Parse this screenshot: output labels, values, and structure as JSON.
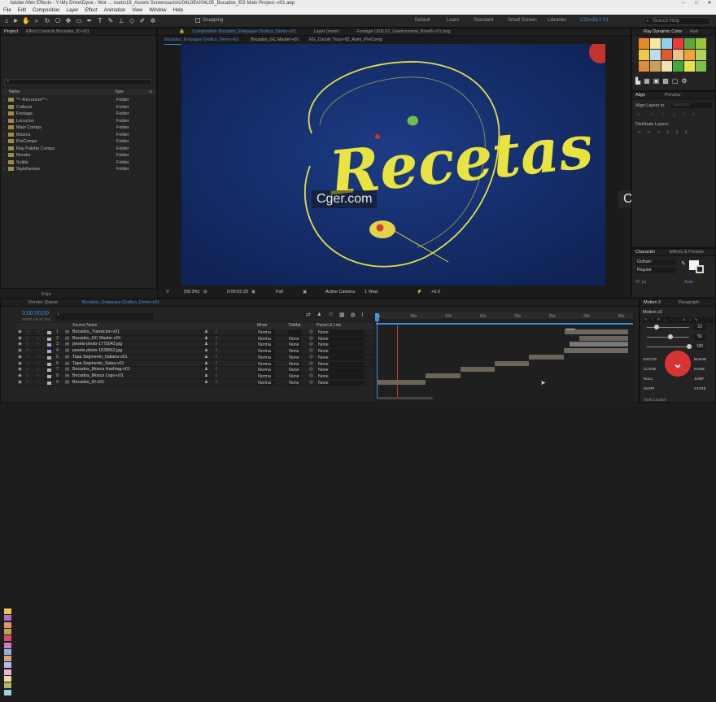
{
  "titlebar": {
    "title": "Adobe After Effects - Y:\\My Drive\\Dyne - Wor ... ssets\\18_Assets Screencasts\\U04L05\\U04L05_Bocados_EG Main Project--v01.aep"
  },
  "menu": [
    "File",
    "Edit",
    "Composition",
    "Layer",
    "Effect",
    "Animation",
    "View",
    "Window",
    "Help"
  ],
  "toolbar": {
    "snapping": "Snapping",
    "workspaces": [
      "Default",
      "Learn",
      "Standard",
      "Small Screen",
      "Libraries",
      "COnsDLY 01"
    ],
    "active_workspace": "COnsDLY 01",
    "search_placeholder": "Search Help"
  },
  "project": {
    "tab": "Project",
    "effect_tab": "Effect Controls Bocados_ID-v01",
    "col_name": "Name",
    "col_type": "Type",
    "items": [
      {
        "name": "**--Recursos**--",
        "type": "Folder"
      },
      {
        "name": "Collects",
        "type": "Folder"
      },
      {
        "name": "Footage",
        "type": "Folder"
      },
      {
        "name": "Locucion",
        "type": "Folder"
      },
      {
        "name": "Main Comps",
        "type": "Folder"
      },
      {
        "name": "Musica",
        "type": "Folder"
      },
      {
        "name": "PreComps",
        "type": "Folder"
      },
      {
        "name": "Ray Palette Comps",
        "type": "Folder"
      },
      {
        "name": "Render",
        "type": "Folder"
      },
      {
        "name": "Solids",
        "type": "Folder"
      },
      {
        "name": "Styleframes",
        "type": "Folder"
      }
    ],
    "bpc": "8 bpc"
  },
  "comp": {
    "tab1": "Composition Bocados_Empaque Grafico_Demo-v01",
    "tab2": "Layer (none)",
    "tab3": "Footage U03L02_Gastronomia_Bowl6-v01.png",
    "sub1": "Bocados_Empaque Grafico_Demo-v01",
    "sub2": "Bocados_GC Master-v01",
    "sub3": "EG_Circulo Trazo-02_Anim_PreComp",
    "title_text": "Recetas",
    "zoom": "(59.3%)",
    "timecode": "0:00:02:29",
    "resolution": "Full",
    "camera": "Active Camera",
    "view": "1 View",
    "offset": "+0.0"
  },
  "watermark": "Cger.com",
  "ray": {
    "tab": "Ray Dynamic Color",
    "tab2": "Aud",
    "colors": [
      "#e9882a",
      "#f4eba0",
      "#8fd0ea",
      "#ea3a3a",
      "#5aa83a",
      "#9ec43a",
      "#f0c94a",
      "#b7e0ea",
      "#e05a2a",
      "#e9c48a",
      "#f0a33a",
      "#b0d35c",
      "#e28a3a",
      "#c8a060",
      "#f2e0b0",
      "#3fa83f",
      "#e8e24a",
      "#7ac04a"
    ]
  },
  "align": {
    "tab": "Align",
    "tab2": "Preview",
    "align_to": "Align Layers to:",
    "selection": "Selection",
    "distribute": "Distribute Layers:"
  },
  "character": {
    "tab": "Character",
    "tab2": "Effects & Presets",
    "font": "Gotham",
    "style": "Regular",
    "size": "47 px",
    "leading": "Auto"
  },
  "motion": {
    "tab": "Motion 2",
    "tab2": "Paragraph",
    "name": "Motion v2",
    "v1": "23",
    "v2": "56",
    "v3": "100",
    "buttons": [
      "EXCITE",
      "BLEND",
      "CLONE",
      "NAME",
      "NULL",
      "JUMP",
      "SORT",
      "WARP",
      "STARE"
    ],
    "footer": "Task Launch"
  },
  "timeline": {
    "render_tab": "Render Queue",
    "comp_tab": "Bocados_Empaque Grafico_Demo-v01",
    "timecode": "0;00;00;00",
    "fps": "00000 (29.97 fps)",
    "col_source": "Source Name",
    "col_mode": "Mode",
    "col_trkmat": "TrkMat",
    "col_parent": "Parent & Link",
    "ticks": [
      "0s",
      "05s",
      "10s",
      "15s",
      "20s",
      "25s",
      "30s",
      "35s"
    ],
    "layers": [
      {
        "num": "1",
        "name": "Bocados_Transicion-v01",
        "mode": "Norma",
        "trk": "",
        "parent": "None",
        "color": "#b1b1b1"
      },
      {
        "num": "2",
        "name": "Bocados_GC Master-v01",
        "mode": "Norma",
        "trk": "None",
        "parent": "None",
        "color": "#b1b1b1"
      },
      {
        "num": "3",
        "name": "pexels-photo-1775043.jpg",
        "mode": "Norma",
        "trk": "None",
        "parent": "None",
        "color": "#a8a3d9"
      },
      {
        "num": "4",
        "name": "pexels-photo-1639562.jpg",
        "mode": "Norma",
        "trk": "None",
        "parent": "None",
        "color": "#a8a3d9"
      },
      {
        "num": "5",
        "name": "Tapa Segmento_Italiana-v01",
        "mode": "Norma",
        "trk": "None",
        "parent": "None",
        "color": "#b1b1b1"
      },
      {
        "num": "6",
        "name": "Tapa Segmento_Salsa-v01",
        "mode": "Norma",
        "trk": "None",
        "parent": "None",
        "color": "#b1b1b1"
      },
      {
        "num": "7",
        "name": "Bocados_Mosca Hashtag-v01",
        "mode": "Norma",
        "trk": "None",
        "parent": "None",
        "color": "#b1b1b1"
      },
      {
        "num": "8",
        "name": "Bocados_Mosca Logo-v01",
        "mode": "Norma",
        "trk": "None",
        "parent": "None",
        "color": "#b1b1b1"
      },
      {
        "num": "9",
        "name": "Bocados_ID-v01",
        "mode": "Norma",
        "trk": "None",
        "parent": "None",
        "color": "#b1b1b1"
      }
    ]
  }
}
